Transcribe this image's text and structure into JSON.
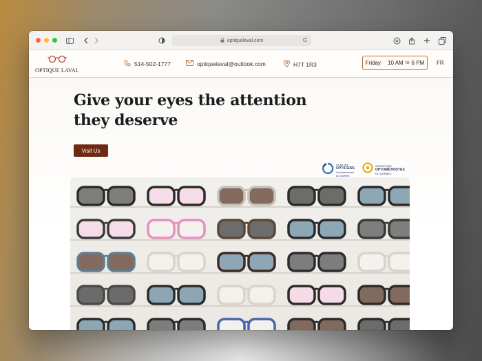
{
  "browser": {
    "url": "optiquelaval.com"
  },
  "header": {
    "logo_text": "OPTIQUE LAVAL",
    "phone": "514-502-1777",
    "email": "optiquelaval@outlook.com",
    "postal_code": "H7T 1R3",
    "hours": {
      "day": "Friday",
      "open": "10 AM",
      "to": "to",
      "close": "6 PM"
    },
    "language": "FR"
  },
  "hero": {
    "headline": "Give your eyes the attention they deserve",
    "cta_label": "Visit Us",
    "affiliations": [
      {
        "name": "OPTICIENS",
        "lines": [
          "Ordre des",
          "OPTICIENS",
          "d'ordonnances",
          "du Québec"
        ]
      },
      {
        "name": "OPTOMÉTRISTES",
        "lines": [
          "ORDRE DES",
          "OPTOMÉTRISTES",
          "DU QUÉBEC"
        ]
      }
    ],
    "image_alt": "Eyeglasses on display wall"
  },
  "colors": {
    "accent": "#6e2a12",
    "accent_border": "#b5713f",
    "icon": "#b5713f"
  }
}
